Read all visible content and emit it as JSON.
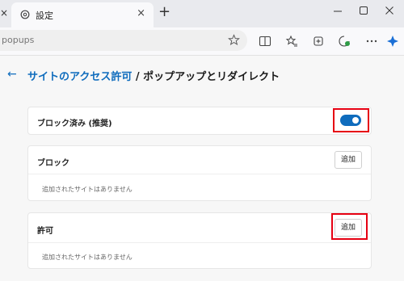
{
  "window": {
    "tab_title": "設定",
    "tab_close_glyph": "×",
    "new_tab_glyph": "+"
  },
  "address": {
    "url": "popups"
  },
  "page": {
    "back_glyph": "←",
    "breadcrumb_parent": "サイトのアクセス許可",
    "breadcrumb_separator": " / ",
    "title": "ポップアップとリダイレクト"
  },
  "settings": {
    "blocked": {
      "label": "ブロック済み (推奨)",
      "toggle_on": true
    },
    "block": {
      "label": "ブロック",
      "add_button": "追加",
      "empty_text": "追加されたサイトはありません"
    },
    "allow": {
      "label": "許可",
      "add_button": "追加",
      "empty_text": "追加されたサイトはありません"
    }
  },
  "colors": {
    "accent": "#0f6cbd",
    "highlight": "#e60012"
  }
}
